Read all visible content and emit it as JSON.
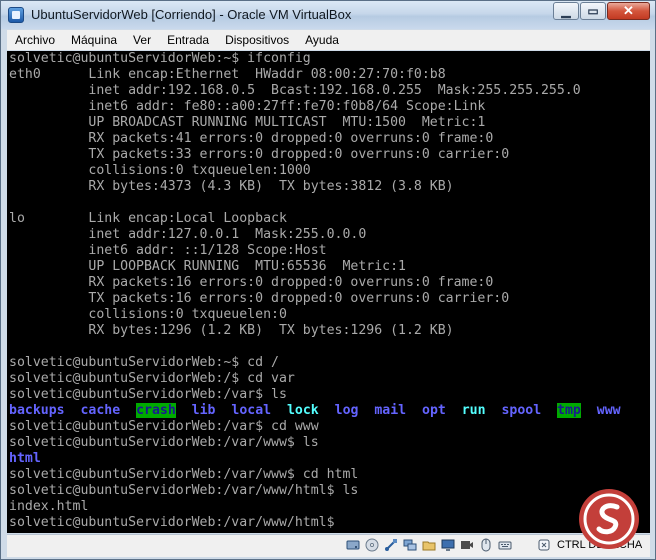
{
  "window": {
    "title": "UbuntuServidorWeb [Corriendo] - Oracle VM VirtualBox"
  },
  "menu": [
    "Archivo",
    "Máquina",
    "Ver",
    "Entrada",
    "Dispositivos",
    "Ayuda"
  ],
  "terminal": {
    "line00": "solvetic@ubuntuServidorWeb:~$ ifconfig",
    "line01": "eth0      Link encap:Ethernet  HWaddr 08:00:27:70:f0:b8",
    "line02": "          inet addr:192.168.0.5  Bcast:192.168.0.255  Mask:255.255.255.0",
    "line03": "          inet6 addr: fe80::a00:27ff:fe70:f0b8/64 Scope:Link",
    "line04": "          UP BROADCAST RUNNING MULTICAST  MTU:1500  Metric:1",
    "line05": "          RX packets:41 errors:0 dropped:0 overruns:0 frame:0",
    "line06": "          TX packets:33 errors:0 dropped:0 overruns:0 carrier:0",
    "line07": "          collisions:0 txqueuelen:1000",
    "line08": "          RX bytes:4373 (4.3 KB)  TX bytes:3812 (3.8 KB)",
    "line10": "lo        Link encap:Local Loopback",
    "line11": "          inet addr:127.0.0.1  Mask:255.0.0.0",
    "line12": "          inet6 addr: ::1/128 Scope:Host",
    "line13": "          UP LOOPBACK RUNNING  MTU:65536  Metric:1",
    "line14": "          RX packets:16 errors:0 dropped:0 overruns:0 frame:0",
    "line15": "          TX packets:16 errors:0 dropped:0 overruns:0 carrier:0",
    "line16": "          collisions:0 txqueuelen:0",
    "line17": "          RX bytes:1296 (1.2 KB)  TX bytes:1296 (1.2 KB)",
    "line19": "solvetic@ubuntuServidorWeb:~$ cd /",
    "line20": "solvetic@ubuntuServidorWeb:/$ cd var",
    "line21": "solvetic@ubuntuServidorWeb:/var$ ls",
    "ls_var": [
      {
        "name": "backups",
        "style": "dir-blue"
      },
      {
        "name": "cache",
        "style": "dir-blue"
      },
      {
        "name": "crash",
        "style": "dir-green-bg"
      },
      {
        "name": "lib",
        "style": "dir-blue"
      },
      {
        "name": "local",
        "style": "dir-blue"
      },
      {
        "name": "lock",
        "style": "dir-cyan"
      },
      {
        "name": "log",
        "style": "dir-blue"
      },
      {
        "name": "mail",
        "style": "dir-blue"
      },
      {
        "name": "opt",
        "style": "dir-blue"
      },
      {
        "name": "run",
        "style": "dir-cyan"
      },
      {
        "name": "spool",
        "style": "dir-blue"
      },
      {
        "name": "tmp",
        "style": "dir-green-bg"
      },
      {
        "name": "www",
        "style": "dir-blue"
      }
    ],
    "line23": "solvetic@ubuntuServidorWeb:/var$ cd www",
    "line24": "solvetic@ubuntuServidorWeb:/var/www$ ls",
    "line25": "html",
    "line26": "solvetic@ubuntuServidorWeb:/var/www$ cd html",
    "line27": "solvetic@ubuntuServidorWeb:/var/www/html$ ls",
    "line28": "index.html",
    "line29": "solvetic@ubuntuServidorWeb:/var/www/html$ "
  },
  "statusbar": {
    "host_key": "CTRL DERECHA",
    "icons": [
      "hard-disk-icon",
      "optical-drive-icon",
      "usb-icon",
      "network-icon",
      "shared-folders-icon",
      "display-icon",
      "recording-icon",
      "mouse-integration-icon",
      "keyboard-icon",
      "host-key-icon"
    ]
  },
  "colors": {
    "terminal_bg": "#000000",
    "terminal_text": "#aaaaaa",
    "dir_blue": "#6464ff",
    "dir_cyan": "#54ffff",
    "dir_green_bg": "#00aa00",
    "close_button": "#c94a32",
    "watermark": "#c33f3a"
  }
}
